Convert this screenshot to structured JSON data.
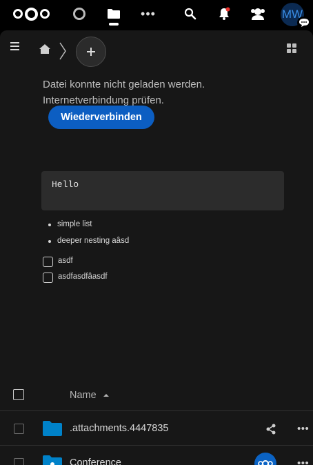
{
  "header": {
    "user_initials": "MW"
  },
  "breadcrumb": {},
  "editor": {
    "error_line1": "Datei konnte nicht geladen werden.",
    "error_line2": "Internetverbindung prüfen.",
    "reconnect_label": "Wiederverbinden",
    "code_text": "Hello",
    "bullets": [
      "simple list",
      "deeper nesting aâsd"
    ],
    "tasks": [
      "asdf",
      "asdfasdfâasdf"
    ]
  },
  "file_list": {
    "name_header": "Name",
    "rows": [
      {
        "name": ".attachments.4447835"
      },
      {
        "name": "Conference"
      }
    ]
  },
  "colors": {
    "accent": "#0c5ec2",
    "folder": "#0082c9",
    "background": "#171717",
    "header": "#000000"
  }
}
